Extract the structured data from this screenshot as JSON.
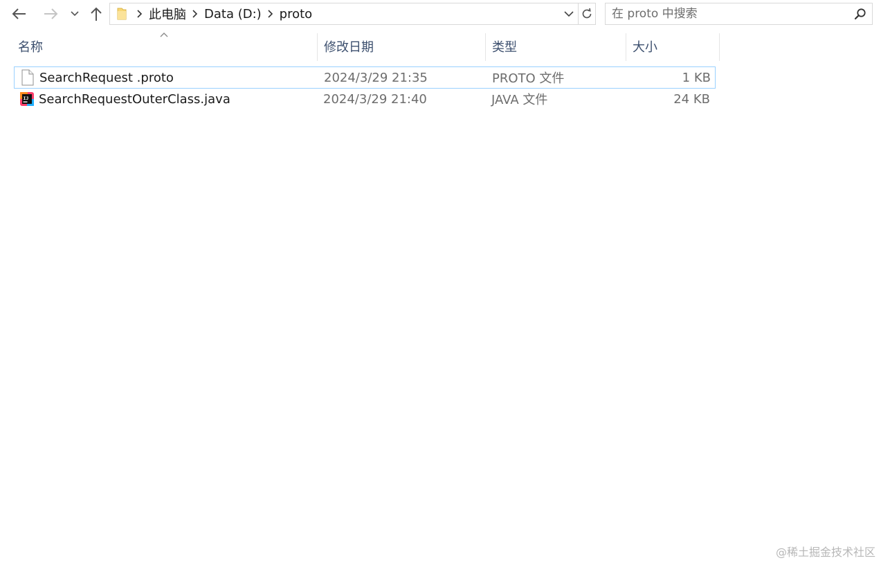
{
  "nav": {
    "back_icon": "arrow-left-icon",
    "forward_icon": "arrow-right-icon",
    "recent_icon": "chevron-down-icon",
    "up_icon": "arrow-up-icon"
  },
  "address": {
    "folder_icon": "folder-icon",
    "breadcrumbs": [
      "此电脑",
      "Data (D:)",
      "proto"
    ]
  },
  "search": {
    "placeholder": "在 proto 中搜索",
    "value": ""
  },
  "columns": {
    "name": "名称",
    "modified": "修改日期",
    "type": "类型",
    "size": "大小"
  },
  "files": [
    {
      "name": "SearchRequest .proto",
      "modified": "2024/3/29 21:35",
      "type": "PROTO 文件",
      "size": "1 KB",
      "icon": "blank-file-icon",
      "selected": true
    },
    {
      "name": "SearchRequestOuterClass.java",
      "modified": "2024/3/29 21:40",
      "type": "JAVA 文件",
      "size": "24 KB",
      "icon": "intellij-java-file-icon",
      "selected": false
    }
  ],
  "watermark": "@稀土掘金技术社区",
  "colors": {
    "selection_border": "#99d1ff",
    "header_text": "#3c4f6e",
    "muted_text": "#6d6d6d",
    "folder_yellow": "#f8d775"
  }
}
